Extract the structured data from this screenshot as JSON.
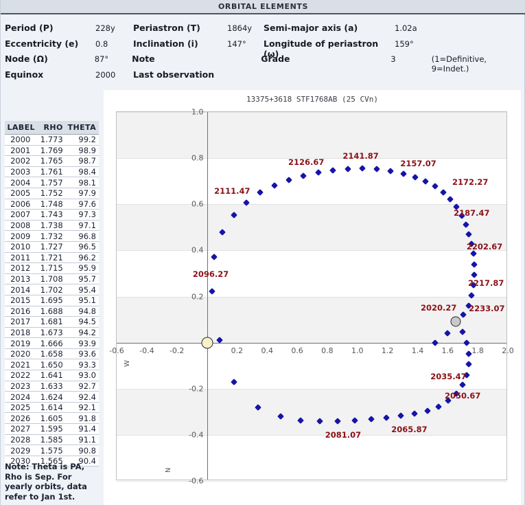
{
  "header": {
    "title": "ORBITAL ELEMENTS"
  },
  "elements": {
    "rows": [
      [
        {
          "label": "Period (P)",
          "value": "228y"
        },
        {
          "label": "Periastron (T)",
          "value": "1864y"
        },
        {
          "label": "Semi-major axis (a)",
          "value": "1.02a"
        }
      ],
      [
        {
          "label": "Eccentricity (e)",
          "value": "0.8"
        },
        {
          "label": "Inclination (i)",
          "value": "147°"
        },
        {
          "label": "Longitude of periastron (ω)",
          "value": "159°"
        }
      ],
      [
        {
          "label": "Node (Ω)",
          "value": "87°"
        },
        {
          "label": "Note",
          "value": ""
        },
        {
          "label": "Grade",
          "value": "3",
          "extra": "(1=Definitive, 9=Indet.)"
        }
      ],
      [
        {
          "label": "Equinox",
          "value": "2000"
        },
        {
          "label": "Last observation",
          "value": ""
        },
        {
          "label": "",
          "value": ""
        }
      ]
    ]
  },
  "ephemeris": {
    "columns": [
      "LABEL",
      "RHO",
      "THETA"
    ],
    "rows": [
      [
        "2000",
        "1.773",
        "99.2"
      ],
      [
        "2001",
        "1.769",
        "98.9"
      ],
      [
        "2002",
        "1.765",
        "98.7"
      ],
      [
        "2003",
        "1.761",
        "98.4"
      ],
      [
        "2004",
        "1.757",
        "98.1"
      ],
      [
        "2005",
        "1.752",
        "97.9"
      ],
      [
        "2006",
        "1.748",
        "97.6"
      ],
      [
        "2007",
        "1.743",
        "97.3"
      ],
      [
        "2008",
        "1.738",
        "97.1"
      ],
      [
        "2009",
        "1.732",
        "96.8"
      ],
      [
        "2010",
        "1.727",
        "96.5"
      ],
      [
        "2011",
        "1.721",
        "96.2"
      ],
      [
        "2012",
        "1.715",
        "95.9"
      ],
      [
        "2013",
        "1.708",
        "95.7"
      ],
      [
        "2014",
        "1.702",
        "95.4"
      ],
      [
        "2015",
        "1.695",
        "95.1"
      ],
      [
        "2016",
        "1.688",
        "94.8"
      ],
      [
        "2017",
        "1.681",
        "94.5"
      ],
      [
        "2018",
        "1.673",
        "94.2"
      ],
      [
        "2019",
        "1.666",
        "93.9"
      ],
      [
        "2020",
        "1.658",
        "93.6"
      ],
      [
        "2021",
        "1.650",
        "93.3"
      ],
      [
        "2022",
        "1.641",
        "93.0"
      ],
      [
        "2023",
        "1.633",
        "92.7"
      ],
      [
        "2024",
        "1.624",
        "92.4"
      ],
      [
        "2025",
        "1.614",
        "92.1"
      ],
      [
        "2026",
        "1.605",
        "91.8"
      ],
      [
        "2027",
        "1.595",
        "91.4"
      ],
      [
        "2028",
        "1.585",
        "91.1"
      ],
      [
        "2029",
        "1.575",
        "90.8"
      ],
      [
        "2030",
        "1.565",
        "90.4"
      ]
    ]
  },
  "note": "Note: Theta is PA, Rho is Sep. For yearly orbits, data refer to Jan 1st.",
  "chart_data": {
    "type": "scatter",
    "title": "13375+3618 STF1768AB (25 CVn)",
    "xlabel": "W",
    "ylabel": "N",
    "xlim": [
      -0.6,
      2.0
    ],
    "ylim": [
      -0.6,
      1.0
    ],
    "xticks": [
      "-0.6",
      "-0.4",
      "-0.2",
      "0.2",
      "0.4",
      "0.6",
      "0.8",
      "1.0",
      "1.2",
      "1.4",
      "1.6",
      "1.8",
      "2.0"
    ],
    "xtickvals": [
      -0.6,
      -0.4,
      -0.2,
      0.2,
      0.4,
      0.6,
      0.8,
      1.0,
      1.2,
      1.4,
      1.6,
      1.8,
      2.0
    ],
    "yticks": [
      "1.0",
      "0.8",
      "0.6",
      "0.4",
      "0.2",
      "-0.2",
      "-0.4",
      "-0.6"
    ],
    "ytickvals": [
      1.0,
      0.8,
      0.6,
      0.4,
      0.2,
      -0.2,
      -0.4,
      -0.6
    ],
    "grid": true,
    "bands": [
      [
        0.8,
        1.0
      ],
      [
        0.4,
        0.6
      ],
      [
        0.0,
        0.2
      ],
      [
        -0.4,
        -0.2
      ]
    ],
    "legend": "none",
    "primary_star": {
      "x": 0.0,
      "y": 0.0,
      "color": "#f7f2c8",
      "name": "primary-star-marker"
    },
    "secondary_star": {
      "x": 1.655,
      "y": 0.092,
      "color": "#c9c9c9",
      "name": "secondary-star-marker"
    },
    "point_color": "#1515a8",
    "label_color": "#8b1118",
    "series": [
      {
        "name": "orbit-ephemeris-points",
        "points": [
          {
            "x": 1.655,
            "y": 0.092,
            "label": "2020.27"
          },
          {
            "x": 1.7,
            "y": 0.048
          },
          {
            "x": 1.728,
            "y": 0.0
          },
          {
            "x": 1.742,
            "y": -0.048
          },
          {
            "x": 1.742,
            "y": -0.093,
            "label": "2035.47"
          },
          {
            "x": 1.728,
            "y": -0.14
          },
          {
            "x": 1.7,
            "y": -0.184
          },
          {
            "x": 1.658,
            "y": -0.222
          },
          {
            "x": 1.605,
            "y": -0.252
          },
          {
            "x": 1.54,
            "y": -0.277,
            "label": "2050.67"
          },
          {
            "x": 1.465,
            "y": -0.295
          },
          {
            "x": 1.38,
            "y": -0.308
          },
          {
            "x": 1.29,
            "y": -0.318
          },
          {
            "x": 1.192,
            "y": -0.325,
            "label": "2065.87"
          },
          {
            "x": 1.09,
            "y": -0.332
          },
          {
            "x": 0.982,
            "y": -0.338
          },
          {
            "x": 0.868,
            "y": -0.34
          },
          {
            "x": 0.748,
            "y": -0.34,
            "label": "2081.07"
          },
          {
            "x": 0.622,
            "y": -0.338
          },
          {
            "x": 0.488,
            "y": -0.32
          },
          {
            "x": 0.34,
            "y": -0.28
          },
          {
            "x": 0.178,
            "y": -0.172
          },
          {
            "x": 0.085,
            "y": 0.01
          },
          {
            "x": 0.032,
            "y": 0.222,
            "label": "2096.27"
          },
          {
            "x": 0.048,
            "y": 0.372
          },
          {
            "x": 0.102,
            "y": 0.478
          },
          {
            "x": 0.178,
            "y": 0.552
          },
          {
            "x": 0.262,
            "y": 0.608,
            "label": "2111.47"
          },
          {
            "x": 0.352,
            "y": 0.652
          },
          {
            "x": 0.448,
            "y": 0.682
          },
          {
            "x": 0.545,
            "y": 0.705
          },
          {
            "x": 0.642,
            "y": 0.724,
            "label": "2126.67"
          },
          {
            "x": 0.74,
            "y": 0.738
          },
          {
            "x": 0.838,
            "y": 0.748
          },
          {
            "x": 0.935,
            "y": 0.753
          },
          {
            "x": 1.032,
            "y": 0.755,
            "label": "2141.87"
          },
          {
            "x": 1.128,
            "y": 0.752
          },
          {
            "x": 1.222,
            "y": 0.745
          },
          {
            "x": 1.305,
            "y": 0.733
          },
          {
            "x": 1.382,
            "y": 0.718,
            "label": "2157.07"
          },
          {
            "x": 1.452,
            "y": 0.7
          },
          {
            "x": 1.515,
            "y": 0.678
          },
          {
            "x": 1.572,
            "y": 0.652
          },
          {
            "x": 1.618,
            "y": 0.622,
            "label": "2172.27"
          },
          {
            "x": 1.66,
            "y": 0.588
          },
          {
            "x": 1.695,
            "y": 0.55
          },
          {
            "x": 1.722,
            "y": 0.512
          },
          {
            "x": 1.742,
            "y": 0.47,
            "label": "2187.47"
          },
          {
            "x": 1.76,
            "y": 0.428
          },
          {
            "x": 1.772,
            "y": 0.385
          },
          {
            "x": 1.778,
            "y": 0.34
          },
          {
            "x": 1.778,
            "y": 0.295,
            "label": "2202.67"
          },
          {
            "x": 1.772,
            "y": 0.25
          },
          {
            "x": 1.758,
            "y": 0.205
          },
          {
            "x": 1.738,
            "y": 0.16
          },
          {
            "x": 1.705,
            "y": 0.12,
            "label": "2217.87"
          },
          {
            "x": 1.598,
            "y": 0.04
          },
          {
            "x": 1.518,
            "y": 0.0
          }
        ]
      }
    ],
    "annotations": [
      {
        "text": "2020.27",
        "x": 1.54,
        "y": 0.152
      },
      {
        "text": "2035.47",
        "x": 1.605,
        "y": -0.148
      },
      {
        "text": "2050.67",
        "x": 1.7,
        "y": -0.232
      },
      {
        "text": "2065.87",
        "x": 1.345,
        "y": -0.378
      },
      {
        "text": "2081.07",
        "x": 0.905,
        "y": -0.4
      },
      {
        "text": "2096.27",
        "x": 0.025,
        "y": 0.298
      },
      {
        "text": "2111.47",
        "x": 0.168,
        "y": 0.658
      },
      {
        "text": "2126.67",
        "x": 0.66,
        "y": 0.782
      },
      {
        "text": "2141.87",
        "x": 1.022,
        "y": 0.808
      },
      {
        "text": "2157.07",
        "x": 1.405,
        "y": 0.778
      },
      {
        "text": "2172.27",
        "x": 1.75,
        "y": 0.695
      },
      {
        "text": "2187.47",
        "x": 1.76,
        "y": 0.562
      },
      {
        "text": "2202.67",
        "x": 1.845,
        "y": 0.415
      },
      {
        "text": "2217.87",
        "x": 1.855,
        "y": 0.258
      },
      {
        "text": "2233.07",
        "x": 1.86,
        "y": 0.148
      }
    ]
  }
}
